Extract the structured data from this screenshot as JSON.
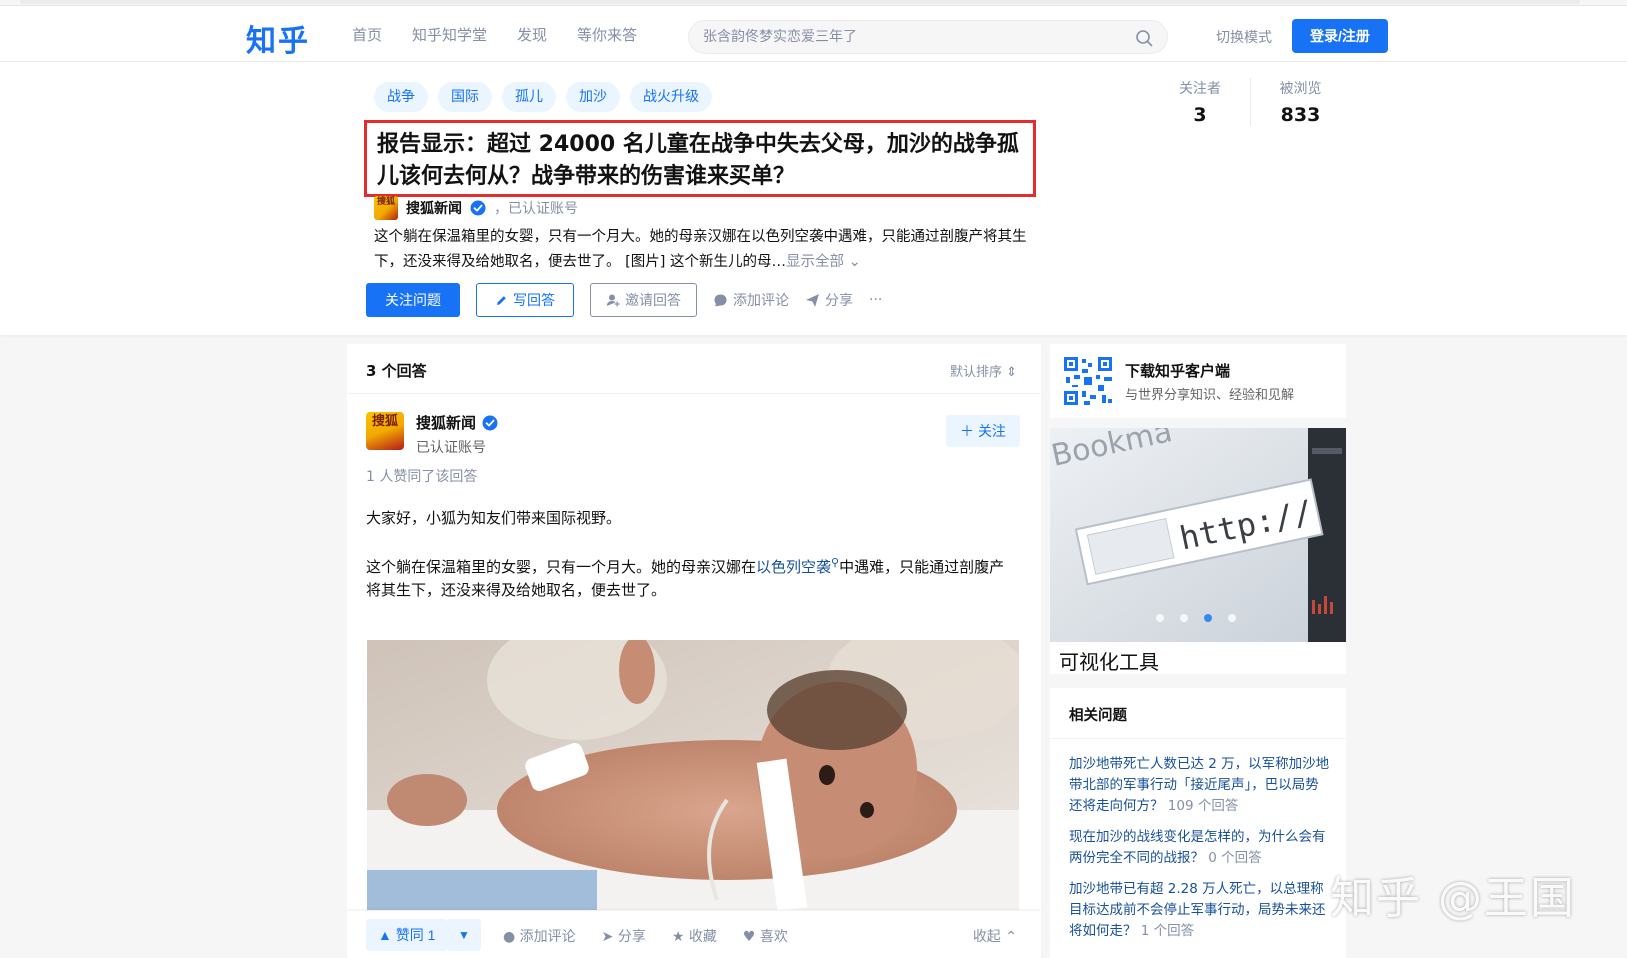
{
  "header": {
    "logo": "知乎",
    "nav": [
      "首页",
      "知乎知学堂",
      "发现",
      "等你来答"
    ],
    "search_placeholder": "张含韵佟梦实恋爱三年了",
    "switch_mode": "切换模式",
    "login": "登录/注册",
    "accent_color": "#1772f6"
  },
  "question": {
    "tags": [
      "战争",
      "国际",
      "孤儿",
      "加沙",
      "战火升级"
    ],
    "title": "报告显示：超过 24000 名儿童在战争中失去父母，加沙的战争孤儿该何去何从？战争带来的伤害谁来买单？",
    "highlight_color": "#e52b2b",
    "author": {
      "avatar_text": "搜狐",
      "name": "搜狐新闻",
      "verified_label": "，已认证账号"
    },
    "description": "这个躺在保温箱里的女婴，只有一个月大。她的母亲汉娜在以色列空袭中遇难，只能通过剖腹产将其生下，还没来得及给她取名，便去世了。 [图片] 这个新生儿的母…",
    "show_all": "显示全部",
    "stats": {
      "followers_label": "关注者",
      "followers": "3",
      "views_label": "被浏览",
      "views": "833"
    },
    "actions": {
      "follow": "关注问题",
      "write": "写回答",
      "invite": "邀请回答",
      "comment": "添加评论",
      "share": "分享",
      "more": "···"
    }
  },
  "answers": {
    "count": "3 个回答",
    "sort": "默认排序",
    "author_avatar_text": "搜狐",
    "author_name": "搜狐新闻",
    "author_sub": "已认证账号",
    "follow": "关注",
    "voters": "1 人赞同了该回答",
    "p1": "大家好，小狐为知友们带来国际视野。",
    "p2_before": "这个躺在保温箱里的女婴，只有一个月大。她的母亲汉娜在",
    "p2_link": "以色列空袭",
    "p2_after": "中遇难，只能通过剖腹产将其生下，还没来得及给她取名，便去世了。",
    "vote_up": "▲ 赞同 1",
    "vote_down": "▼",
    "bar": {
      "comment": "添加评论",
      "share": "分享",
      "collect": "收藏",
      "like": "喜欢",
      "collapse": "收起"
    }
  },
  "sidebar": {
    "app_title": "下载知乎客户端",
    "app_sub": "与世界分享知识、经验和见解",
    "ad_caption": "可视化工具",
    "ad_image_text": "http://",
    "related_title": "相关问题",
    "related": [
      {
        "q": "加沙地带死亡人数已达 2 万，以军称加沙地带北部的军事行动「接近尾声」，巴以局势还将走向何方？",
        "count": "109 个回答"
      },
      {
        "q": "现在加沙的战线变化是怎样的，为什么会有两份完全不同的战报？",
        "count": "0 个回答"
      },
      {
        "q": "加沙地带已有超 2.28 万人死亡，以总理称目标达成前不会停止军事行动，局势未来还将如何走？",
        "count": "1 个回答"
      }
    ]
  },
  "watermark": "知乎 @王国"
}
